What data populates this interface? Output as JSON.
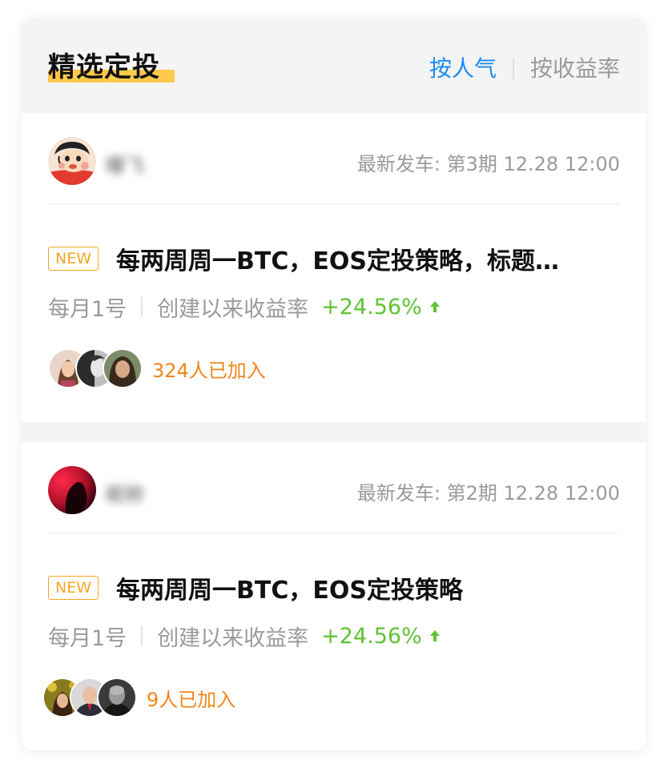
{
  "header": {
    "title": "精选定投",
    "sort_tabs": [
      {
        "label": "按人气",
        "active": true
      },
      {
        "label": "按收益率",
        "active": false
      }
    ]
  },
  "plans": [
    {
      "author_name": "曝飞",
      "author_avatar_icon": "cartoon-boy-avatar",
      "release": "最新发车: 第3期 12.28 12:00",
      "badge": "NEW",
      "title": "每两周周一BTC，EOS定投策略，标题…",
      "frequency": "每月1号",
      "rate_label": "创建以来收益率",
      "rate_value": "+24.56%",
      "joined": "324人已加入"
    },
    {
      "author_name": "昵称",
      "author_avatar_icon": "silhouette-avatar",
      "release": "最新发车: 第2期 12.28 12:00",
      "badge": "NEW",
      "title": "每两周周一BTC，EOS定投策略",
      "frequency": "每月1号",
      "rate_label": "创建以来收益率",
      "rate_value": "+24.56%",
      "joined": "9人已加入"
    }
  ],
  "colors": {
    "accent_blue": "#1a8cf0",
    "highlight_yellow": "#ffc94a",
    "badge_orange": "#f5a623",
    "join_orange": "#f0861c",
    "profit_green": "#5fc234",
    "muted_gray": "#9a9a9a"
  }
}
